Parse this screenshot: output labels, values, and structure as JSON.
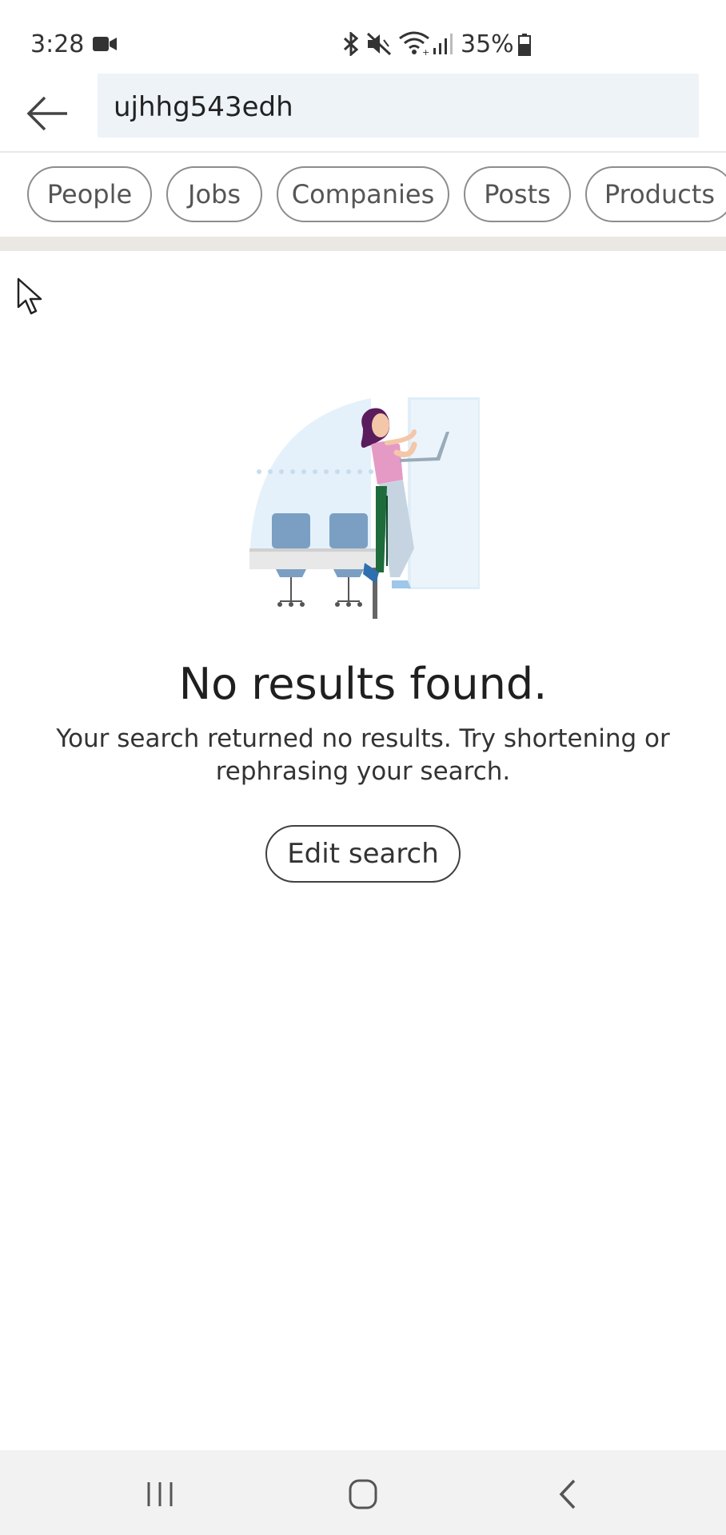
{
  "status_bar": {
    "time": "3:28",
    "battery": "35%",
    "icons": [
      "video-camera-icon",
      "bluetooth-icon",
      "mute-icon",
      "wifi-icon",
      "signal-icon",
      "battery-icon"
    ]
  },
  "search": {
    "value": "ujhhg543edh",
    "back_icon": "back-arrow-icon"
  },
  "filters": {
    "chips": [
      {
        "label": "People"
      },
      {
        "label": "Jobs"
      },
      {
        "label": "Companies"
      },
      {
        "label": "Posts"
      },
      {
        "label": "Products"
      }
    ]
  },
  "empty_state": {
    "illustration": "person-with-laptop-illustration",
    "title": "No results found.",
    "message": "Your search returned no results. Try shortening or rephrasing your search.",
    "button_label": "Edit search"
  },
  "nav_bar": {
    "items": [
      "recent-apps-icon",
      "home-icon",
      "back-icon"
    ]
  },
  "colors": {
    "search_bg": "#eef3f8",
    "chip_border": "#8c8c8c",
    "divider": "#ebe8e4",
    "nav_bg": "#f2f2f2",
    "illustration_blue": "#7a9fc2",
    "illustration_pink": "#e59ac6",
    "illustration_hair": "#5a1c5c",
    "illustration_green": "#1e6b3c"
  }
}
